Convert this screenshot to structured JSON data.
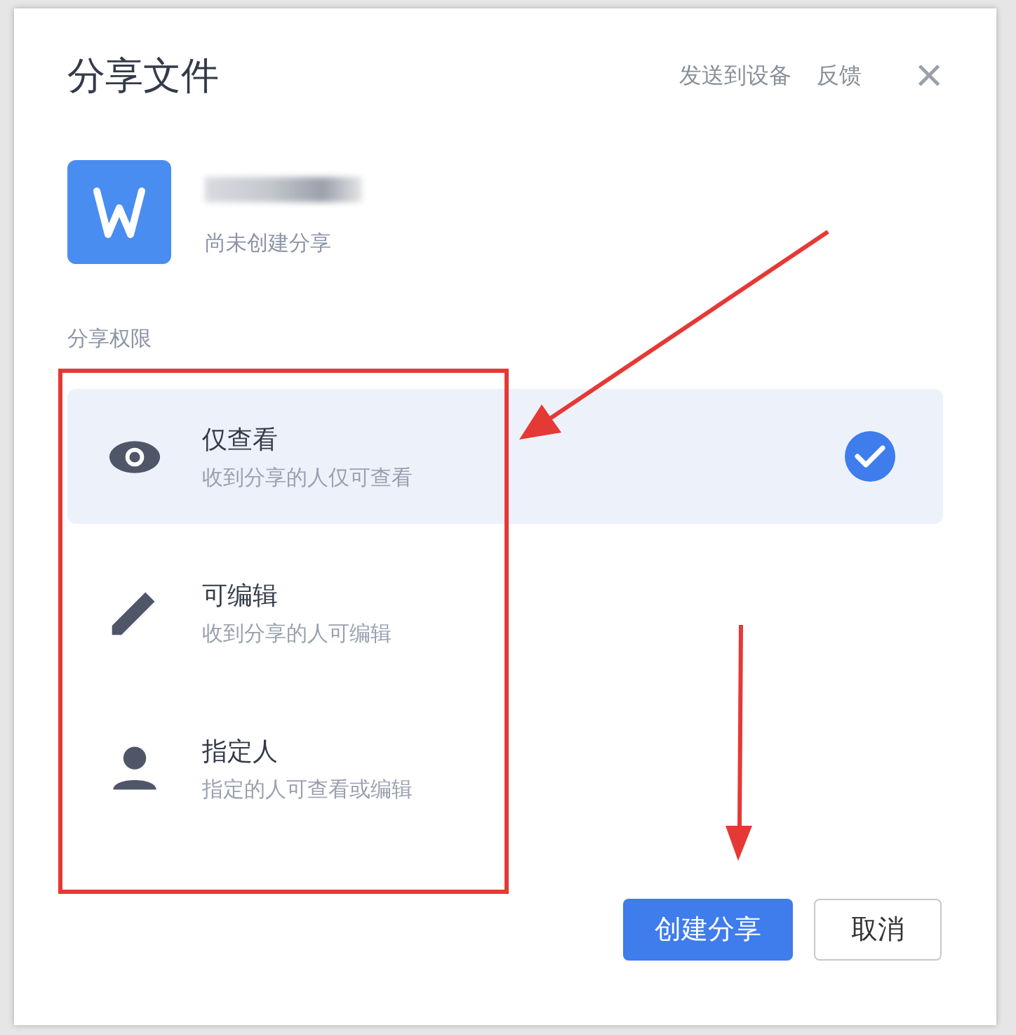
{
  "dialog": {
    "title": "分享文件",
    "links": [
      "发送到设备",
      "反馈"
    ],
    "close": "×"
  },
  "file": {
    "status": "尚未创建分享"
  },
  "permissions": {
    "label": "分享权限",
    "options": [
      {
        "kind": "view",
        "title": "仅查看",
        "description": "收到分享的人仅可查看",
        "selected": true
      },
      {
        "kind": "edit",
        "title": "可编辑",
        "description": "收到分享的人可编辑",
        "selected": false
      },
      {
        "kind": "person",
        "title": "指定人",
        "description": "指定的人可查看或编辑",
        "selected": false
      }
    ]
  },
  "buttons": [
    {
      "label": "创建分享",
      "kind": "primary"
    },
    {
      "label": "取消",
      "kind": "secondary"
    }
  ]
}
